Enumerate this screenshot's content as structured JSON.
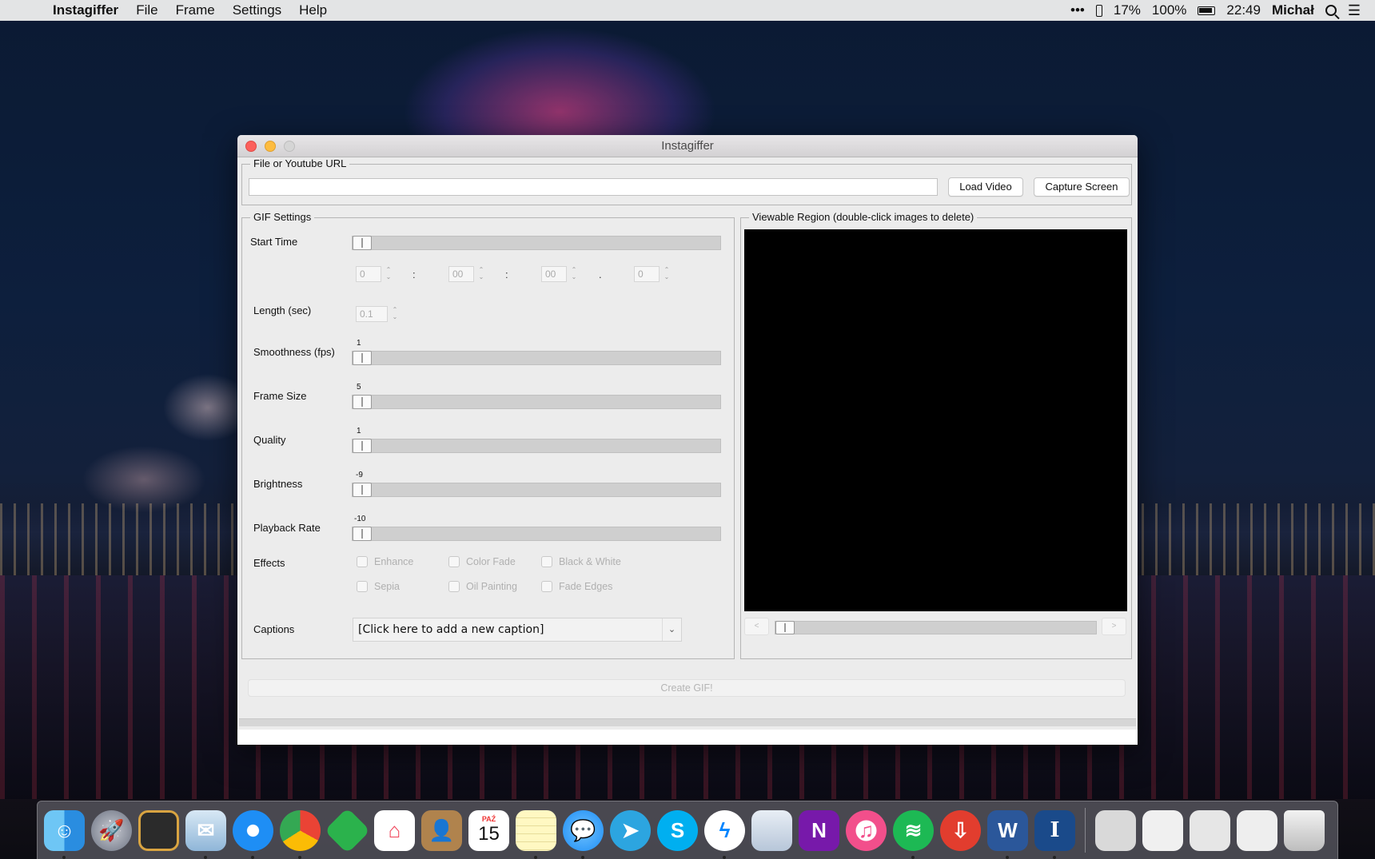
{
  "menubar": {
    "apple_glyph": "",
    "app_name": "Instagiffer",
    "menus": [
      "File",
      "Frame",
      "Settings",
      "Help"
    ],
    "status": {
      "more": "•••",
      "phone_battery": "17%",
      "battery": "100%",
      "time": "22:49",
      "user": "Michał"
    }
  },
  "window": {
    "title": "Instagiffer",
    "url_group": {
      "title": "File or Youtube URL",
      "url_value": "",
      "load_button": "Load Video",
      "capture_button": "Capture Screen"
    },
    "gif_settings": {
      "title": "GIF Settings",
      "start_time_label": "Start Time",
      "start_time": {
        "hours": "0",
        "minutes": "00",
        "seconds": "00",
        "fraction": "0",
        "sep1": ":",
        "sep2": ":",
        "sep3": "."
      },
      "length_label": "Length (sec)",
      "length_value": "0.1",
      "smoothness_label": "Smoothness (fps)",
      "smoothness_value": "1",
      "frame_size_label": "Frame Size",
      "frame_size_value": "5",
      "quality_label": "Quality",
      "quality_value": "1",
      "brightness_label": "Brightness",
      "brightness_value": "-9",
      "playback_label": "Playback Rate",
      "playback_value": "-10",
      "effects_label": "Effects",
      "effects": [
        "Enhance",
        "Color Fade",
        "Black & White",
        "Sepia",
        "Oil Painting",
        "Fade Edges"
      ],
      "captions_label": "Captions",
      "caption_select": "[Click here to add a new caption]"
    },
    "viewable": {
      "title": "Viewable Region (double-click images to delete)",
      "prev": "<",
      "next": ">"
    },
    "create_button": "Create GIF!"
  },
  "dock": {
    "apps": [
      "Finder",
      "Launchpad",
      "Photo Slideshow",
      "Mail",
      "Safari",
      "Chrome",
      "Feedly",
      "Pocket",
      "Contacts",
      "Calendar",
      "Notes",
      "Messages",
      "Telegram",
      "Skype",
      "Messenger",
      "Preview",
      "OneNote",
      "iTunes",
      "Spotify",
      "Transmit",
      "Word",
      "Instagiffer"
    ],
    "calendar_month": "PAŹ",
    "calendar_day": "15"
  }
}
